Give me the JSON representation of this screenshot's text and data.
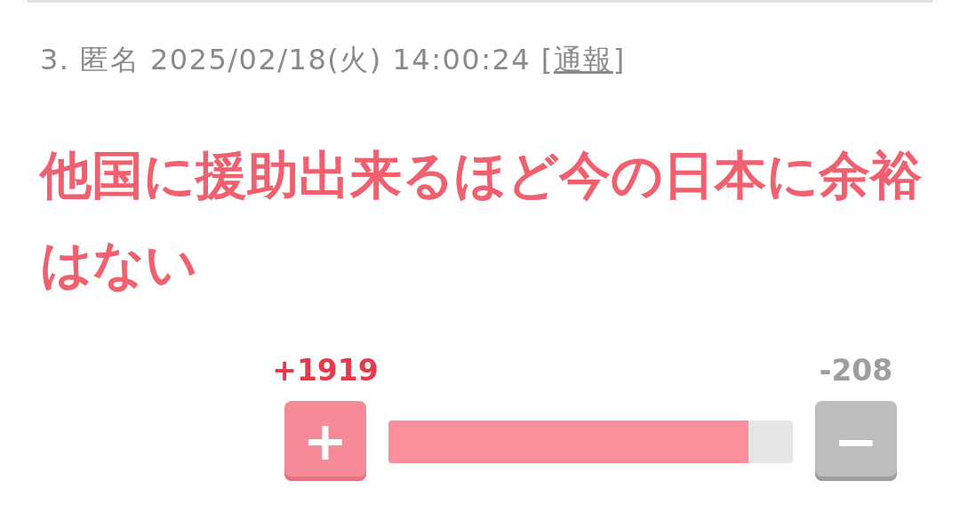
{
  "comment": {
    "number": "3.",
    "author": "匿名",
    "date": "2025/02/18(火) 14:00:24",
    "report_open": "[",
    "report_link": "通報",
    "report_close": "]",
    "text": "他国に援助出来るほど今の日本に余裕はない"
  },
  "votes": {
    "plus_count": "+1919",
    "minus_count": "-208",
    "level": 0.89,
    "plus_label": "+",
    "minus_label": "−"
  }
}
